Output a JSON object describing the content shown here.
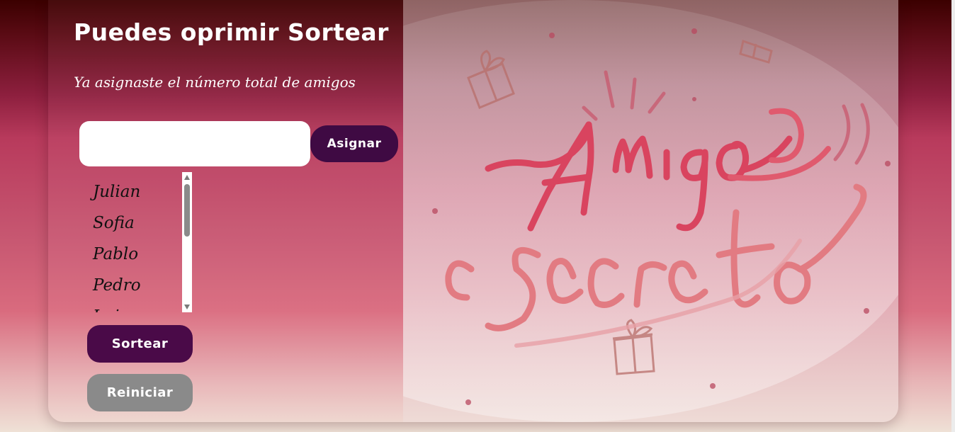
{
  "panel": {
    "title": "Puedes oprimir Sortear",
    "subtitle": "Ya asignaste el número total de amigos"
  },
  "name_input": {
    "value": "",
    "placeholder": ""
  },
  "buttons": {
    "assign_label": "Asignar",
    "draw_label": "Sortear",
    "reset_label": "Reiniciar"
  },
  "friends": [
    "Julian",
    "Sofia",
    "Pablo",
    "Pedro",
    "Luis"
  ],
  "hero": {
    "image_alt": "Amigo secreto",
    "lettering_line1": "Amigo",
    "lettering_line2": "secreto",
    "icon_names": [
      "gift-icon"
    ]
  },
  "colors": {
    "primary_button": "#4a0a48",
    "assign_button": "#3f0a43",
    "reset_button": "#8a8a8a",
    "lettering": "#d9445f",
    "background_top": "#3b0000"
  }
}
